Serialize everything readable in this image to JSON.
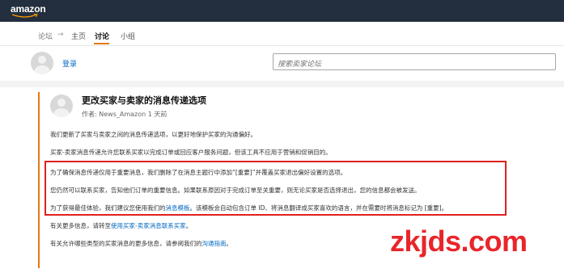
{
  "header": {
    "logo_text": "amazon",
    "brand_color": "#232f3e",
    "accent_color": "#e47911"
  },
  "nav": {
    "forum": "论坛",
    "separator": "→",
    "home": "主页",
    "discuss": "讨论",
    "group": "小组"
  },
  "userbar": {
    "login": "登录",
    "search_placeholder": "搜索卖家论坛"
  },
  "post": {
    "title": "更改买家与卖家的消息传递选项",
    "author_prefix": "作者:",
    "author": "News_Amazon",
    "time": "1 天前",
    "p1": "我们更新了买家与卖家之间的消息传递选项，以更好地保护买家的沟通偏好。",
    "p2": "买家-卖家消息传递允许您联系买家以完成订单或回应客户服务问题，但该工具不应用于营销和促销目的。",
    "p3": "为了确保消息传递仅用于重要消息，我们删除了在消息主题行中添加“[重要]”并覆盖买家退出偏好设置的选项。",
    "p4": "您仍然可以联系买家，告知他们订单的重要信息。如果联系原因对于完成订单至关重要，则无论买家是否选择退出，您的信息都会被发送。",
    "p5_a": "为了获得最佳体验，我们建议您使用我们的",
    "p5_link": "消息模板",
    "p5_b": "。该模板会自动包含订单 ID、将消息翻译成买家喜欢的语言，并在需要时将消息标记为 [重要]。",
    "p6_a": "有关更多信息，请转至",
    "p6_link": "使用买家-卖家消息联系买家",
    "p6_b": "。",
    "p7_a": "有关允许哪些类型的买家消息的更多信息，请参阅我们的",
    "p7_link": "沟通指南",
    "p7_b": "。"
  },
  "watermark": "zkjds.com"
}
